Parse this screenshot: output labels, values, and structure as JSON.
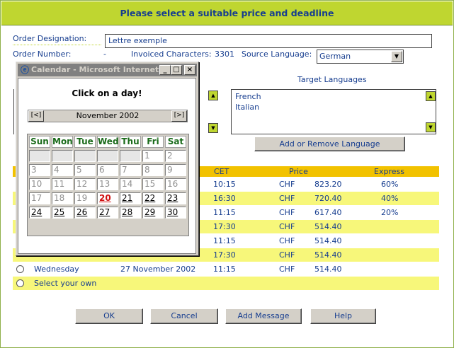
{
  "header": {
    "title": "Please select a suitable price and deadline"
  },
  "order": {
    "designation_label": "Order Designation:",
    "designation_value": "Lettre exemple",
    "number_label": "Order Number:",
    "number_value": "-",
    "invoiced_label": "Invoiced Characters:",
    "invoiced_value": "3301",
    "source_label": "Source Language:",
    "source_value": "German"
  },
  "target": {
    "label": "Target Languages",
    "items": [
      "French",
      "Italian"
    ],
    "button": "Add or Remove Language"
  },
  "table": {
    "headers": {
      "cet": "CET",
      "price": "Price",
      "express": "Express"
    },
    "rows": [
      {
        "time": "10:15",
        "cur": "CHF",
        "price": "823.20",
        "express": "60%"
      },
      {
        "time": "16:30",
        "cur": "CHF",
        "price": "720.40",
        "express": "40%"
      },
      {
        "time": "11:15",
        "cur": "CHF",
        "price": "617.40",
        "express": "20%"
      },
      {
        "time": "17:30",
        "cur": "CHF",
        "price": "514.40",
        "express": ""
      },
      {
        "time": "11:15",
        "cur": "CHF",
        "price": "514.40",
        "express": ""
      },
      {
        "time": "17:30",
        "cur": "CHF",
        "price": "514.40",
        "express": ""
      },
      {
        "day": "Wednesday",
        "date": "27 November 2002",
        "time": "11:15",
        "cur": "CHF",
        "price": "514.40",
        "express": ""
      }
    ],
    "own": "Select your own"
  },
  "buttons": {
    "ok": "OK",
    "cancel": "Cancel",
    "add_message": "Add Message",
    "help": "Help"
  },
  "popup": {
    "title": "Calendar - Microsoft Internet ...",
    "heading": "Click on a day!",
    "month": "November 2002",
    "prev": "[<]",
    "next": "[>]",
    "days": [
      "Sun",
      "Mon",
      "Tue",
      "Wed",
      "Thu",
      "Fri",
      "Sat"
    ],
    "weeks": [
      [
        "",
        "",
        "",
        "",
        "",
        "1",
        "2"
      ],
      [
        "3",
        "4",
        "5",
        "6",
        "7",
        "8",
        "9"
      ],
      [
        "10",
        "11",
        "12",
        "13",
        "14",
        "15",
        "16"
      ],
      [
        "17",
        "18",
        "19",
        "20",
        "21",
        "22",
        "23"
      ],
      [
        "24",
        "25",
        "26",
        "27",
        "28",
        "29",
        "30"
      ]
    ],
    "today": "20"
  },
  "colors": {
    "accent": "#bfd630",
    "text": "#163d8f",
    "row_yellow": "#f7f77a",
    "header_orange": "#f2c200"
  }
}
